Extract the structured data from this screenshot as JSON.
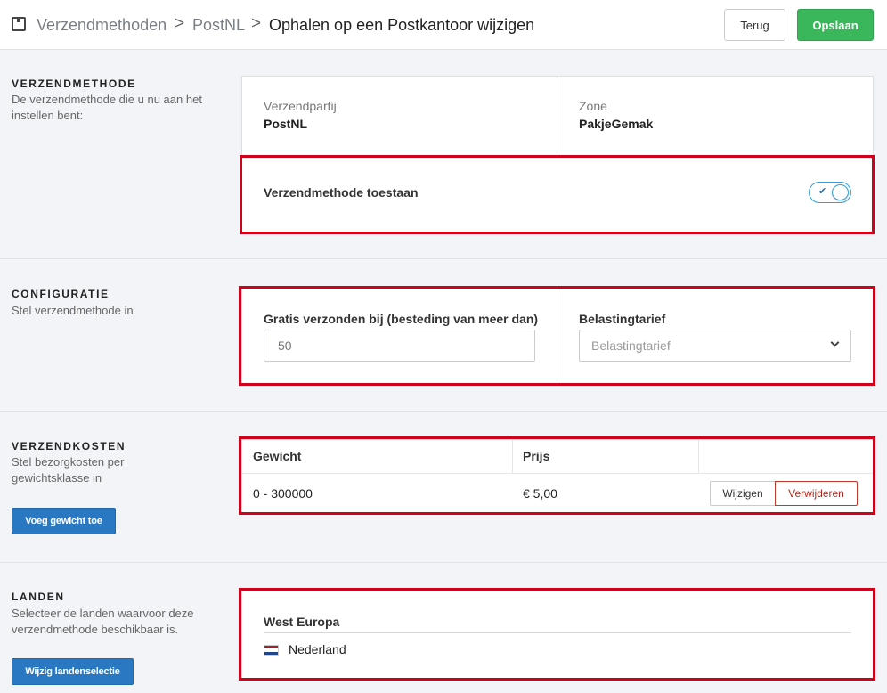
{
  "header": {
    "breadcrumb": [
      "Verzendmethoden",
      "PostNL",
      "Ophalen op een Postkantoor wijzigen"
    ],
    "separator": ">",
    "back_label": "Terug",
    "save_label": "Opslaan"
  },
  "sections": {
    "verzendmethode": {
      "title": "VERZENDMETHODE",
      "description": "De verzendmethode die u nu aan het instellen bent:",
      "carrier_label": "Verzendpartij",
      "carrier_value": "PostNL",
      "zone_label": "Zone",
      "zone_value": "PakjeGemak",
      "allow_label": "Verzendmethode toestaan",
      "allow_enabled": true,
      "toggle_check": "✔"
    },
    "configuratie": {
      "title": "CONFIGURATIE",
      "description": "Stel verzendmethode in",
      "free_shipping_label": "Gratis verzonden bij (besteding van meer dan)",
      "free_shipping_placeholder": "50",
      "tax_label": "Belastingtarief",
      "tax_placeholder": "Belastingtarief"
    },
    "verzendkosten": {
      "title": "VERZENDKOSTEN",
      "description": "Stel bezorgkosten per gewichtsklasse in",
      "columns": [
        "Gewicht",
        "Prijs"
      ],
      "rows": [
        {
          "weight": "0 - 300000",
          "price": "€ 5,00",
          "edit_label": "Wijzigen",
          "delete_label": "Verwijderen"
        }
      ],
      "add_button": "Voeg gewicht toe"
    },
    "landen": {
      "title": "LANDEN",
      "description": "Selecteer de landen waarvoor deze verzendmethode beschikbaar is.",
      "region": "West Europa",
      "countries": [
        {
          "name": "Nederland",
          "flag_colors": [
            "#ae1c28",
            "#ffffff",
            "#21468b"
          ]
        }
      ],
      "change_button": "Wijzig landenselectie"
    }
  },
  "colors": {
    "save_green": "#3ab75a",
    "primary_blue": "#2b78c2",
    "highlight_red": "#d0021b",
    "toggle_blue": "#33a1d6"
  }
}
